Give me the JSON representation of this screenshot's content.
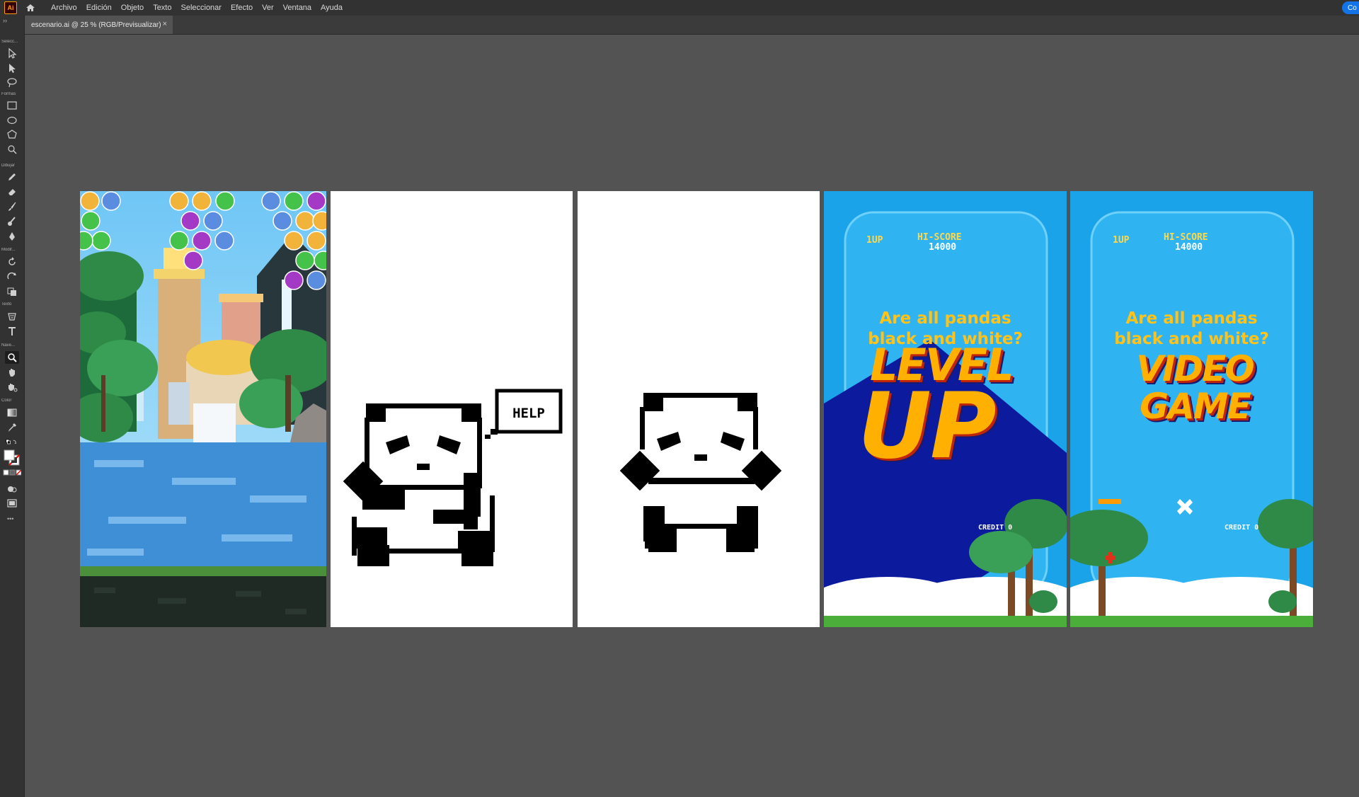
{
  "app": {
    "logo": "Ai",
    "menu": [
      "Archivo",
      "Edición",
      "Objeto",
      "Texto",
      "Seleccionar",
      "Efecto",
      "Ver",
      "Ventana",
      "Ayuda"
    ],
    "share_label": "Co"
  },
  "document_tab": {
    "title": "escenario.ai @ 25 % (RGB/Previsualizar)",
    "close_glyph": "×"
  },
  "toolbar": {
    "collapse_glyph": "››",
    "sections": {
      "select": "Selecc...",
      "shapes": "Formas",
      "draw": "Dibujar",
      "modify": "Modif...",
      "type": "Texto",
      "navigate": "Nave...",
      "color": "Color"
    },
    "more_glyph": "•••"
  },
  "artboards": {
    "level_up": {
      "player_label": "1UP",
      "hiscore_label": "HI-SCORE",
      "hiscore_value": "14000",
      "question_line1": "Are all pandas",
      "question_line2": "black and white?",
      "title_line1": "LEVEL",
      "title_line2": "UP",
      "credit": "CREDIT 0"
    },
    "video_game": {
      "player_label": "1UP",
      "hiscore_label": "HI-SCORE",
      "hiscore_value": "14000",
      "question_line1": "Are all pandas",
      "question_line2": "black and white?",
      "title_line1": "VIDEO",
      "title_line2": "GAME",
      "credit": "CREDIT 0"
    },
    "panda_help": {
      "bubble_text": "HELP"
    }
  },
  "colors": {
    "canvas_bg": "#535353",
    "panel_bg": "#323232",
    "accent_blue": "#1473e6",
    "arcade_yellow": "#ffc21a"
  }
}
